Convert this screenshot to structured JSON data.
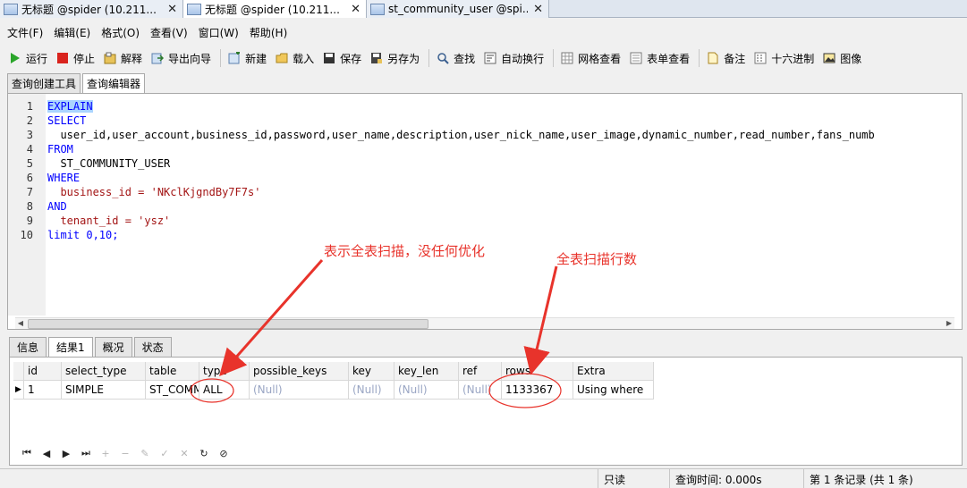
{
  "doc_tabs": [
    {
      "label": "无标题 @spider (10.211...",
      "close": "✕"
    },
    {
      "label": "无标题 @spider (10.211...",
      "close": "✕"
    },
    {
      "label": "st_community_user @spi...",
      "close": "✕"
    }
  ],
  "menu": [
    "文件(F)",
    "编辑(E)",
    "格式(O)",
    "查看(V)",
    "窗口(W)",
    "帮助(H)"
  ],
  "toolbar": {
    "run": "运行",
    "stop": "停止",
    "explain": "解释",
    "export": "导出向导",
    "new": "新建",
    "load": "载入",
    "save": "保存",
    "save_as": "另存为",
    "find": "查找",
    "word_wrap": "自动换行",
    "grid_view": "网格查看",
    "form_view": "表单查看",
    "memo": "备注",
    "hex": "十六进制",
    "image": "图像"
  },
  "panel_tabs": [
    "查询创建工具",
    "查询编辑器"
  ],
  "editor": {
    "line_numbers": [
      "1",
      "2",
      "3",
      "4",
      "5",
      "6",
      "7",
      "8",
      "9",
      "10"
    ],
    "lines": [
      "EXPLAIN",
      "SELECT",
      "  user_id,user_account,business_id,password,user_name,description,user_nick_name,user_image,dynamic_number,read_number,fans_numb",
      "FROM",
      "  ST_COMMUNITY_USER",
      "WHERE",
      "  business_id = 'NKclKjgndBy7F7s'",
      "AND",
      "  tenant_id = 'ysz'",
      "limit 0,10;"
    ]
  },
  "result_tabs": [
    "信息",
    "结果1",
    "概况",
    "状态"
  ],
  "grid": {
    "columns": [
      "id",
      "select_type",
      "table",
      "type",
      "possible_keys",
      "key",
      "key_len",
      "ref",
      "rows",
      "Extra"
    ],
    "rows": [
      [
        "1",
        "SIMPLE",
        "ST_COMMUNITY_USER",
        "ALL",
        "(Null)",
        "(Null)",
        "(Null)",
        "(Null)",
        "1133367",
        "Using where"
      ]
    ]
  },
  "status": {
    "read_only": "只读",
    "query_time": "查询时间: 0.000s",
    "records": "第 1 条记录 (共 1 条)"
  },
  "annotations": {
    "full_scan": "表示全表扫描，没任何优化",
    "rows_scanned": "全表扫描行数"
  },
  "colors": {
    "keyword": "#0000ff",
    "string": "#a31515",
    "annotation": "#e8332b"
  }
}
